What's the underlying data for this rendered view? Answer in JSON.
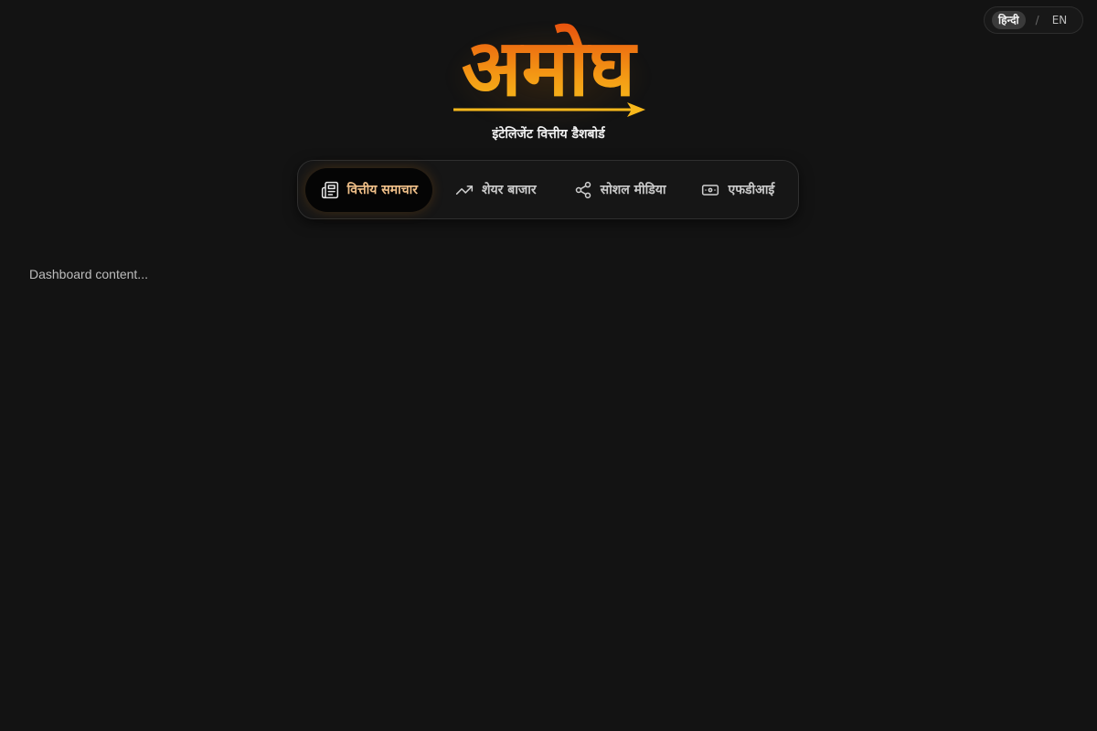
{
  "language_toggle": {
    "hindi": "हिन्दी",
    "separator": "/",
    "english": "EN"
  },
  "brand": {
    "logo_text": "अमोघ",
    "tagline": "इंटेलिजेंट वित्तीय डैशबोर्ड"
  },
  "nav": {
    "tabs": [
      {
        "label": "वित्तीय समाचार",
        "icon": "newspaper-icon",
        "active": true
      },
      {
        "label": "शेयर बाजार",
        "icon": "trending-up-icon",
        "active": false
      },
      {
        "label": "सोशल मीडिया",
        "icon": "share-icon",
        "active": false
      },
      {
        "label": "एफडीआई",
        "icon": "banknote-icon",
        "active": false
      }
    ]
  },
  "main": {
    "placeholder": "Dashboard content..."
  },
  "colors": {
    "background": "#131313",
    "accent": "#f0c089",
    "logo_gradient_top": "#e8520e",
    "logo_gradient_bottom": "#f7c21c"
  }
}
